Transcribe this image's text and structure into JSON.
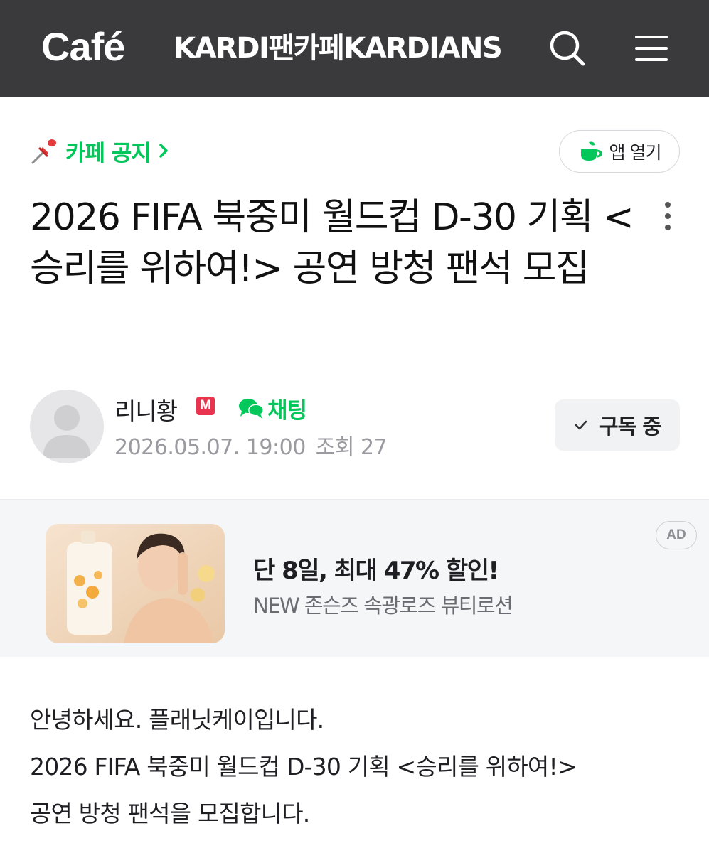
{
  "header": {
    "brand": "Café",
    "cafe_name": "KARDI팬카페KARDIANS",
    "background_color": "#3a3a3c"
  },
  "notice": {
    "label": "카페 공지"
  },
  "app_open": {
    "label": "앱 열기"
  },
  "post": {
    "title": "2026 FIFA 북중미 월드컵 D-30 기획 <승리를 위하여!> 공연 방청 팬석 모집",
    "author": "리니황",
    "grade_badge": "M",
    "chat_label": "채팅",
    "date": "2026.05.07. 19:00",
    "views": "조회 27",
    "subscribe_label": "구독 중",
    "body": [
      "안녕하세요. 플래닛케이입니다.",
      "2026 FIFA 북중미 월드컵 D-30 기획 <승리를 위하여!>",
      "공연 방청 팬석을 모집합니다."
    ]
  },
  "ad": {
    "headline": "단 8일, 최대 47% 할인!",
    "subline": "NEW 존슨즈 속광로즈 뷰티로션",
    "badge": "AD"
  },
  "colors": {
    "accent_green": "#03c75a",
    "grade_red": "#e8344e"
  }
}
